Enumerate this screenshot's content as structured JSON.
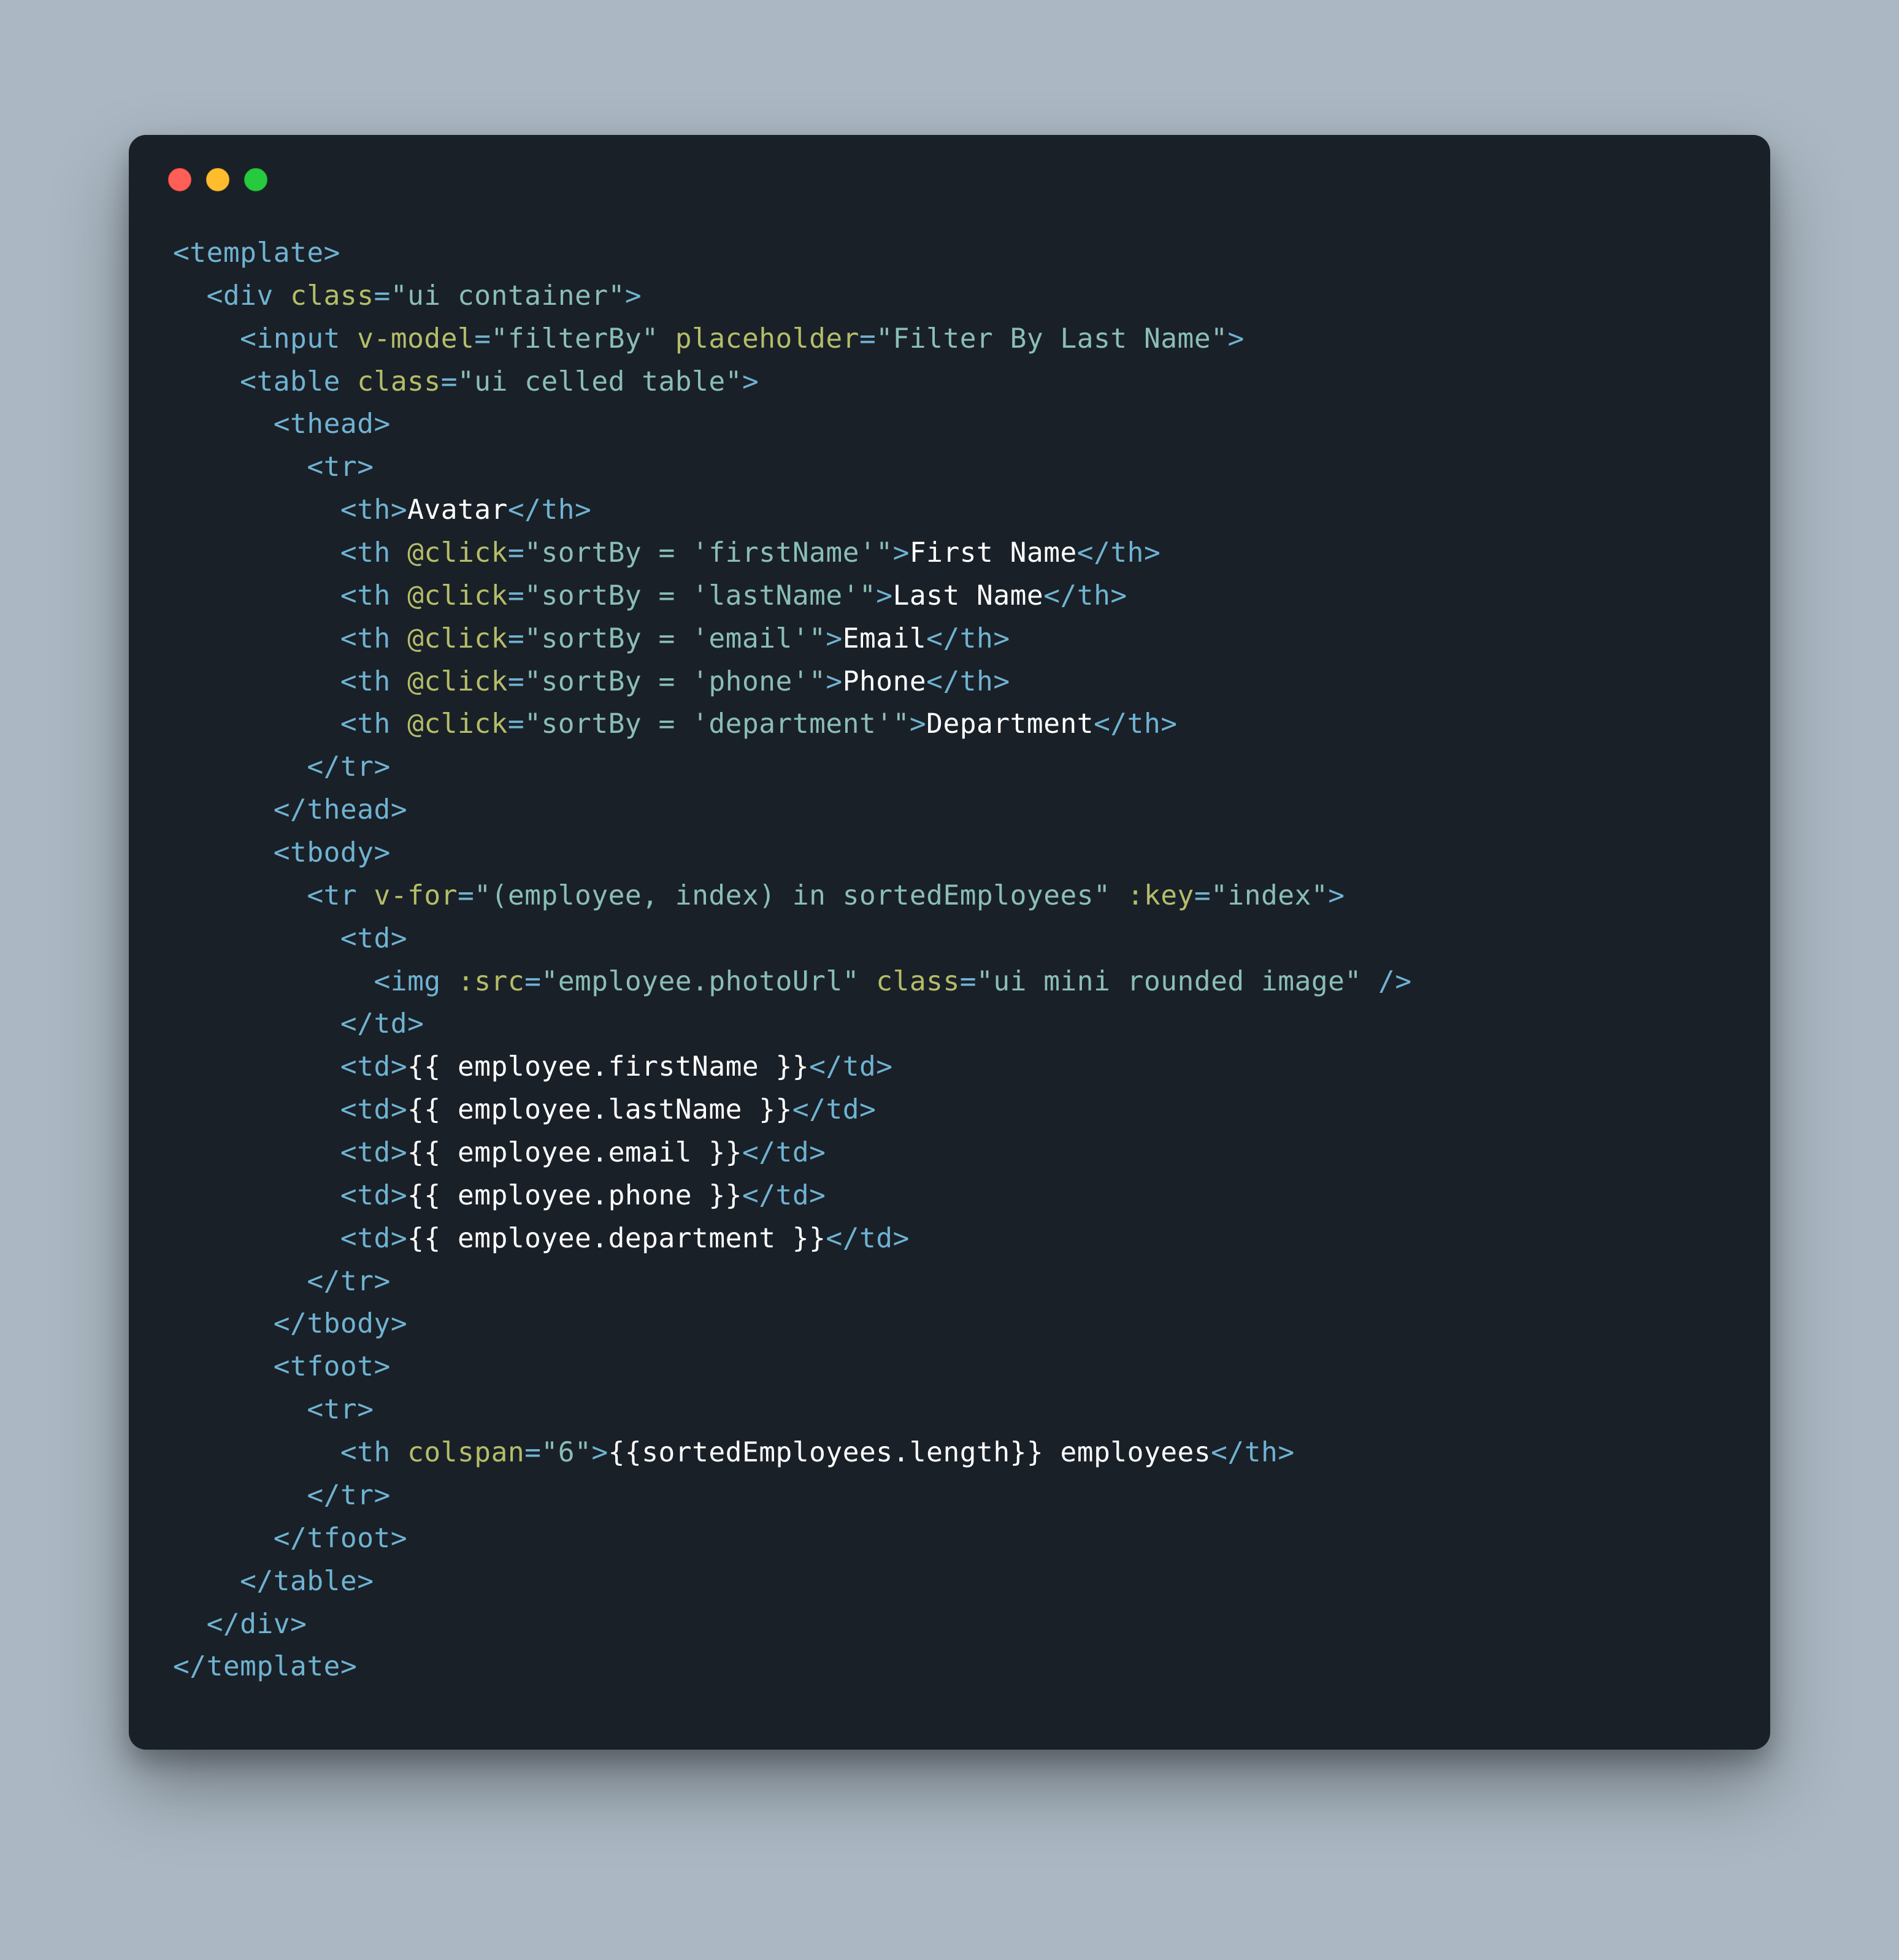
{
  "window": {
    "dots": [
      "close",
      "minimize",
      "zoom"
    ],
    "bg": "#1a2028"
  },
  "code": {
    "l01": {
      "open": "<",
      "tag": "template",
      "close": ">"
    },
    "l02": {
      "open": "<",
      "tag": "div",
      "a1": "class",
      "v1": "\"ui container\"",
      "close": ">"
    },
    "l03": {
      "open": "<",
      "tag": "input",
      "a1": "v-model",
      "v1": "\"filterBy\"",
      "a2": "placeholder",
      "v2": "\"Filter By Last Name\"",
      "close": ">"
    },
    "l04": {
      "open": "<",
      "tag": "table",
      "a1": "class",
      "v1": "\"ui celled table\"",
      "close": ">"
    },
    "l05": {
      "open": "<",
      "tag": "thead",
      "close": ">"
    },
    "l06": {
      "open": "<",
      "tag": "tr",
      "close": ">"
    },
    "l07": {
      "open": "<",
      "tag": "th",
      "close": ">",
      "text": "Avatar",
      "copen": "</",
      "ctag": "th",
      "cclose": ">"
    },
    "l08": {
      "open": "<",
      "tag": "th",
      "a1": "@click",
      "v1": "\"sortBy = 'firstName'\"",
      "close": ">",
      "text": "First Name",
      "copen": "</",
      "ctag": "th",
      "cclose": ">"
    },
    "l09": {
      "open": "<",
      "tag": "th",
      "a1": "@click",
      "v1": "\"sortBy = 'lastName'\"",
      "close": ">",
      "text": "Last Name",
      "copen": "</",
      "ctag": "th",
      "cclose": ">"
    },
    "l10": {
      "open": "<",
      "tag": "th",
      "a1": "@click",
      "v1": "\"sortBy = 'email'\"",
      "close": ">",
      "text": "Email",
      "copen": "</",
      "ctag": "th",
      "cclose": ">"
    },
    "l11": {
      "open": "<",
      "tag": "th",
      "a1": "@click",
      "v1": "\"sortBy = 'phone'\"",
      "close": ">",
      "text": "Phone",
      "copen": "</",
      "ctag": "th",
      "cclose": ">"
    },
    "l12": {
      "open": "<",
      "tag": "th",
      "a1": "@click",
      "v1": "\"sortBy = 'department'\"",
      "close": ">",
      "text": "Department",
      "copen": "</",
      "ctag": "th",
      "cclose": ">"
    },
    "l13": {
      "copen": "</",
      "ctag": "tr",
      "cclose": ">"
    },
    "l14": {
      "copen": "</",
      "ctag": "thead",
      "cclose": ">"
    },
    "l15": {
      "open": "<",
      "tag": "tbody",
      "close": ">"
    },
    "l16": {
      "open": "<",
      "tag": "tr",
      "a1": "v-for",
      "v1": "\"(employee, index) in sortedEmployees\"",
      "a2": ":key",
      "v2": "\"index\"",
      "close": ">"
    },
    "l17": {
      "open": "<",
      "tag": "td",
      "close": ">"
    },
    "l18": {
      "open": "<",
      "tag": "img",
      "a1": ":src",
      "v1": "\"employee.photoUrl\"",
      "a2": "class",
      "v2": "\"ui mini rounded image\"",
      "close": " />"
    },
    "l19": {
      "copen": "</",
      "ctag": "td",
      "cclose": ">"
    },
    "l20": {
      "open": "<",
      "tag": "td",
      "close": ">",
      "text": "{{ employee.firstName }}",
      "copen": "</",
      "ctag": "td",
      "cclose": ">"
    },
    "l21": {
      "open": "<",
      "tag": "td",
      "close": ">",
      "text": "{{ employee.lastName }}",
      "copen": "</",
      "ctag": "td",
      "cclose": ">"
    },
    "l22": {
      "open": "<",
      "tag": "td",
      "close": ">",
      "text": "{{ employee.email }}",
      "copen": "</",
      "ctag": "td",
      "cclose": ">"
    },
    "l23": {
      "open": "<",
      "tag": "td",
      "close": ">",
      "text": "{{ employee.phone }}",
      "copen": "</",
      "ctag": "td",
      "cclose": ">"
    },
    "l24": {
      "open": "<",
      "tag": "td",
      "close": ">",
      "text": "{{ employee.department }}",
      "copen": "</",
      "ctag": "td",
      "cclose": ">"
    },
    "l25": {
      "copen": "</",
      "ctag": "tr",
      "cclose": ">"
    },
    "l26": {
      "copen": "</",
      "ctag": "tbody",
      "cclose": ">"
    },
    "l27": {
      "open": "<",
      "tag": "tfoot",
      "close": ">"
    },
    "l28": {
      "open": "<",
      "tag": "tr",
      "close": ">"
    },
    "l29": {
      "open": "<",
      "tag": "th",
      "a1": "colspan",
      "v1": "\"6\"",
      "close": ">",
      "text": "{{sortedEmployees.length}} employees",
      "copen": "</",
      "ctag": "th",
      "cclose": ">"
    },
    "l30": {
      "copen": "</",
      "ctag": "tr",
      "cclose": ">"
    },
    "l31": {
      "copen": "</",
      "ctag": "tfoot",
      "cclose": ">"
    },
    "l32": {
      "copen": "</",
      "ctag": "table",
      "cclose": ">"
    },
    "l33": {
      "copen": "</",
      "ctag": "div",
      "cclose": ">"
    },
    "l34": {
      "copen": "</",
      "ctag": "template",
      "cclose": ">"
    }
  }
}
